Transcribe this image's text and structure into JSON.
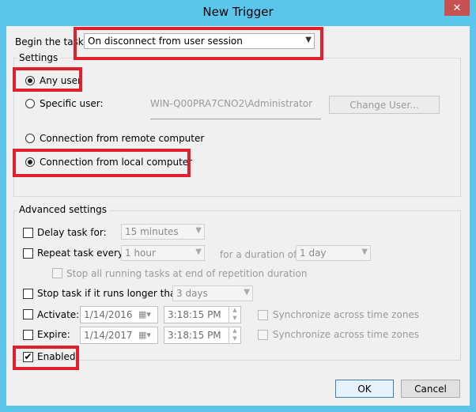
{
  "window": {
    "title": "New Trigger",
    "close_glyph": "✕"
  },
  "begin": {
    "label": "Begin the task:",
    "value": "On disconnect from user session"
  },
  "settings": {
    "title": "Settings",
    "any_user": "Any user",
    "specific_user": "Specific user:",
    "specific_user_value": "WIN-Q00PRA7CNO2\\Administrator",
    "change_user": "Change User...",
    "remote": "Connection from remote computer",
    "local": "Connection from local computer",
    "selected_user_option": "any_user",
    "selected_connection_option": "local"
  },
  "advanced": {
    "title": "Advanced settings",
    "delay_label": "Delay task for:",
    "delay_value": "15 minutes",
    "repeat_label": "Repeat task every:",
    "repeat_value": "1 hour",
    "duration_label": "for a duration of:",
    "duration_value": "1 day",
    "stop_running_label": "Stop all running tasks at end of repetition duration",
    "stop_if_longer_label": "Stop task if it runs longer than:",
    "stop_if_longer_value": "3 days",
    "activate_label": "Activate:",
    "activate_date": "1/14/2016",
    "activate_time": "3:18:15 PM",
    "expire_label": "Expire:",
    "expire_date": "1/14/2017",
    "expire_time": "3:18:15 PM",
    "sync_label": "Synchronize across time zones",
    "enabled_label": "Enabled",
    "enabled_checked": true
  },
  "buttons": {
    "ok": "OK",
    "cancel": "Cancel"
  },
  "colors": {
    "titlebar": "#5bc6ec",
    "highlight": "#e0202d",
    "dialog_bg": "#f0f0f0"
  }
}
